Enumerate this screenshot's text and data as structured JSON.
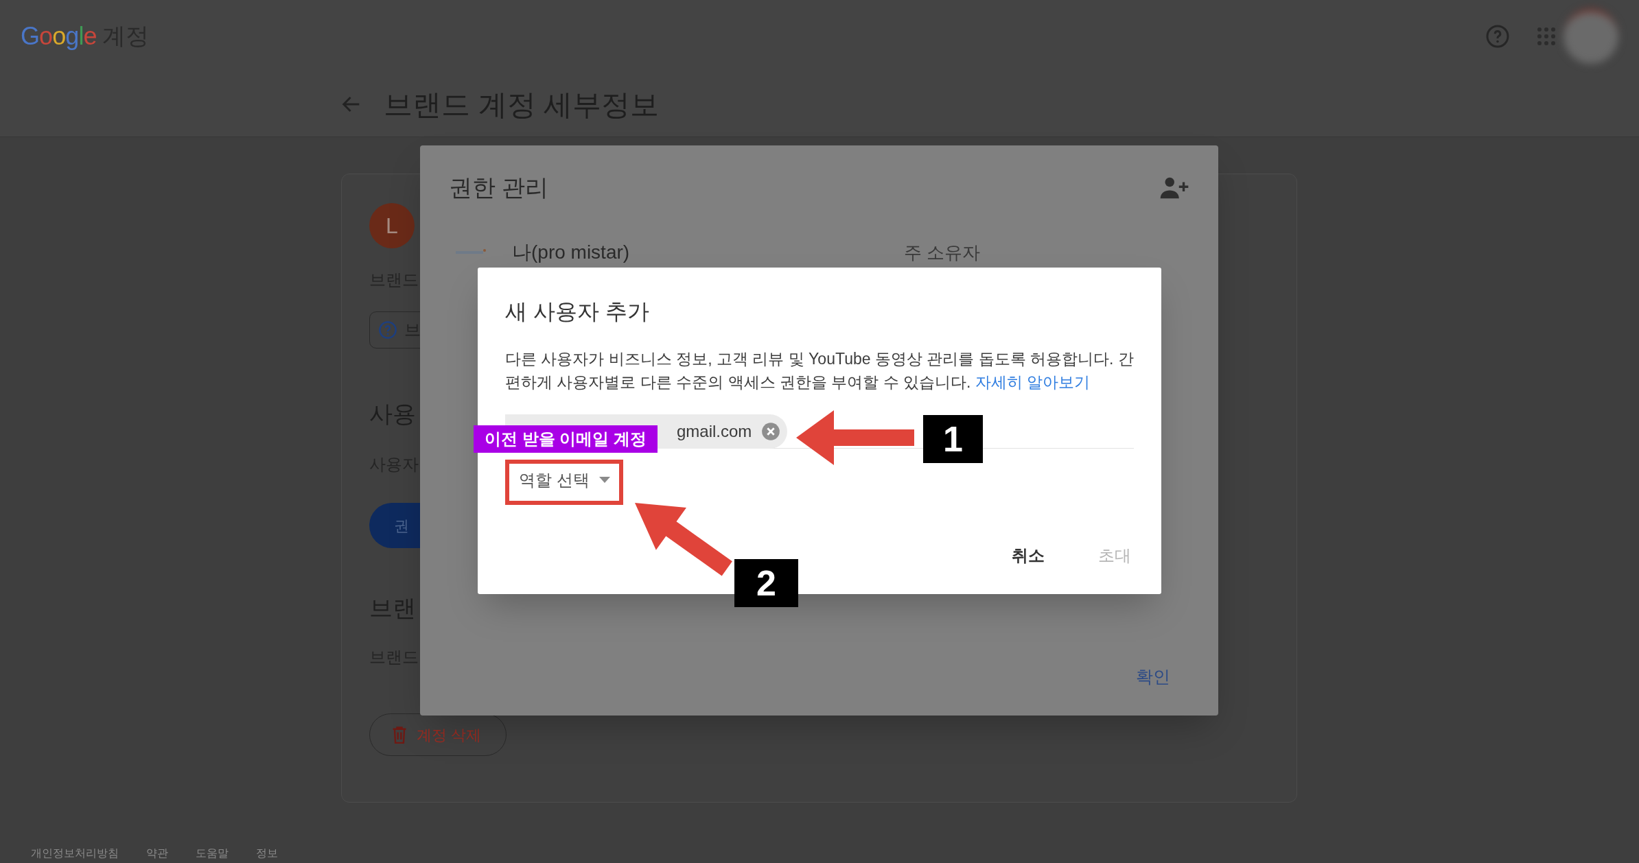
{
  "header": {
    "logo": "Google",
    "product": "계정"
  },
  "page_title": "브랜드 계정 세부정보",
  "card": {
    "avatar_letter": "L",
    "brand_label": "브랜드",
    "help_button": "브",
    "users_heading": "사용",
    "users_text": "사용자",
    "manage_button": "권",
    "brand_heading": "브랜",
    "brand_text": "브랜드",
    "delete_button": "계정 삭제"
  },
  "permissions_dialog": {
    "title": "권한 관리",
    "owner": {
      "name": "나(pro mistar)",
      "role": "주 소유자"
    },
    "confirm": "확인"
  },
  "add_user_dialog": {
    "title": "새 사용자 추가",
    "description": "다른 사용자가 비즈니스 정보, 고객 리뷰 및 YouTube 동영상 관리를 돕도록 허용합니다. 간편하게 사용자별로 다른 수준의 액세스 권한을 부여할 수 있습니다.",
    "learn_more": "자세히 알아보기",
    "email_chip": "gmail.com",
    "role_select": "역할 선택",
    "cancel": "취소",
    "invite": {
      "label": "초대",
      "disabled": true
    }
  },
  "callout_label": "이전 받을 이메일 계정",
  "step_numbers": [
    "1",
    "2"
  ],
  "footer": [
    "개인정보처리방침",
    "약관",
    "도움말",
    "정보"
  ]
}
